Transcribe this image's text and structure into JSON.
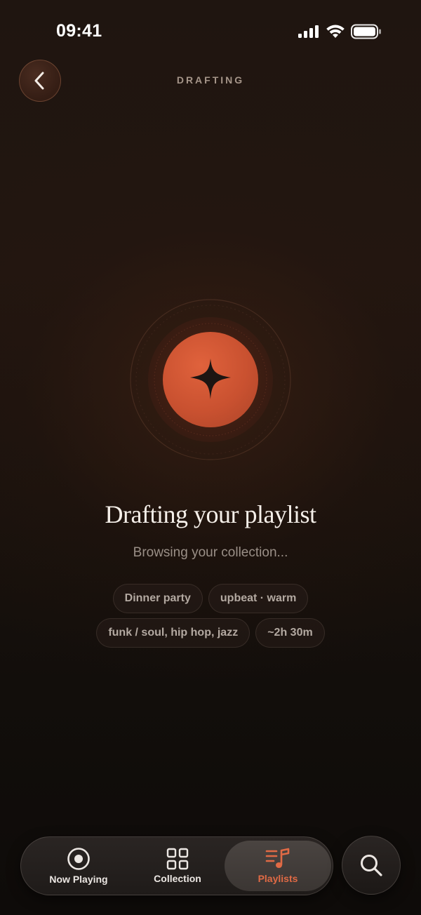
{
  "status_bar": {
    "time": "09:41"
  },
  "header": {
    "title": "DRAFTING",
    "back_icon": "chevron-left-icon"
  },
  "orb": {
    "icon": "sparkle-icon",
    "accent": "#d95a35"
  },
  "main": {
    "headline": "Drafting your playlist",
    "subhead": "Browsing your collection..."
  },
  "chips": [
    "Dinner party",
    "upbeat · warm",
    "funk / soul, hip hop, jazz",
    "~2h 30m"
  ],
  "tab_bar": {
    "tabs": [
      {
        "label": "Now Playing",
        "icon": "record-icon",
        "active": false
      },
      {
        "label": "Collection",
        "icon": "grid-icon",
        "active": false
      },
      {
        "label": "Playlists",
        "icon": "playlist-music-icon",
        "active": true
      }
    ],
    "search_icon": "search-icon"
  },
  "colors": {
    "accent": "#e06a45",
    "text_primary": "#f5efe9",
    "text_muted": "#9a8f87"
  }
}
